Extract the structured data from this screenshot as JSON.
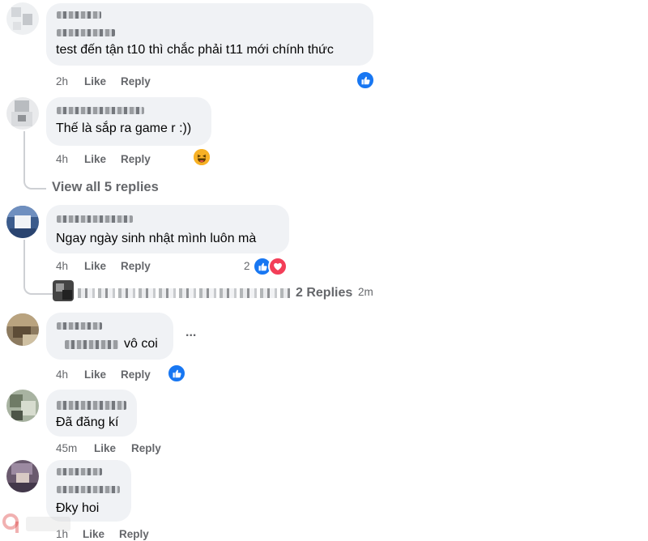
{
  "comments": [
    {
      "text": "test đến tận t10 thì chắc phải t11 mới chính thức",
      "time": "2h",
      "like": "Like",
      "reply": "Reply"
    },
    {
      "text": "Thế là sắp ra game r :))",
      "time": "4h",
      "like": "Like",
      "reply": "Reply",
      "view_replies": "View all 5 replies"
    },
    {
      "text": "Ngay ngày sinh nhật mình luôn mà",
      "time": "4h",
      "like": "Like",
      "reply": "Reply",
      "reaction_count": "2",
      "reply_preview": {
        "replies_label": "2 Replies",
        "time": "2m"
      }
    },
    {
      "text": "vô coi",
      "time": "4h",
      "like": "Like",
      "reply": "Reply",
      "more_icon": "..."
    },
    {
      "text": "Đã đăng kí",
      "time": "45m",
      "like": "Like",
      "reply": "Reply"
    },
    {
      "text": "Đky hoi",
      "time": "1h",
      "like": "Like",
      "reply": "Reply"
    }
  ],
  "colors": {
    "like_blue": "#1877f2",
    "love_red": "#f33e58",
    "bubble": "#f0f2f5",
    "meta": "#65676b"
  },
  "icons": [
    "like-reaction-icon",
    "love-reaction-icon",
    "haha-reaction-icon",
    "more-options-icon"
  ]
}
